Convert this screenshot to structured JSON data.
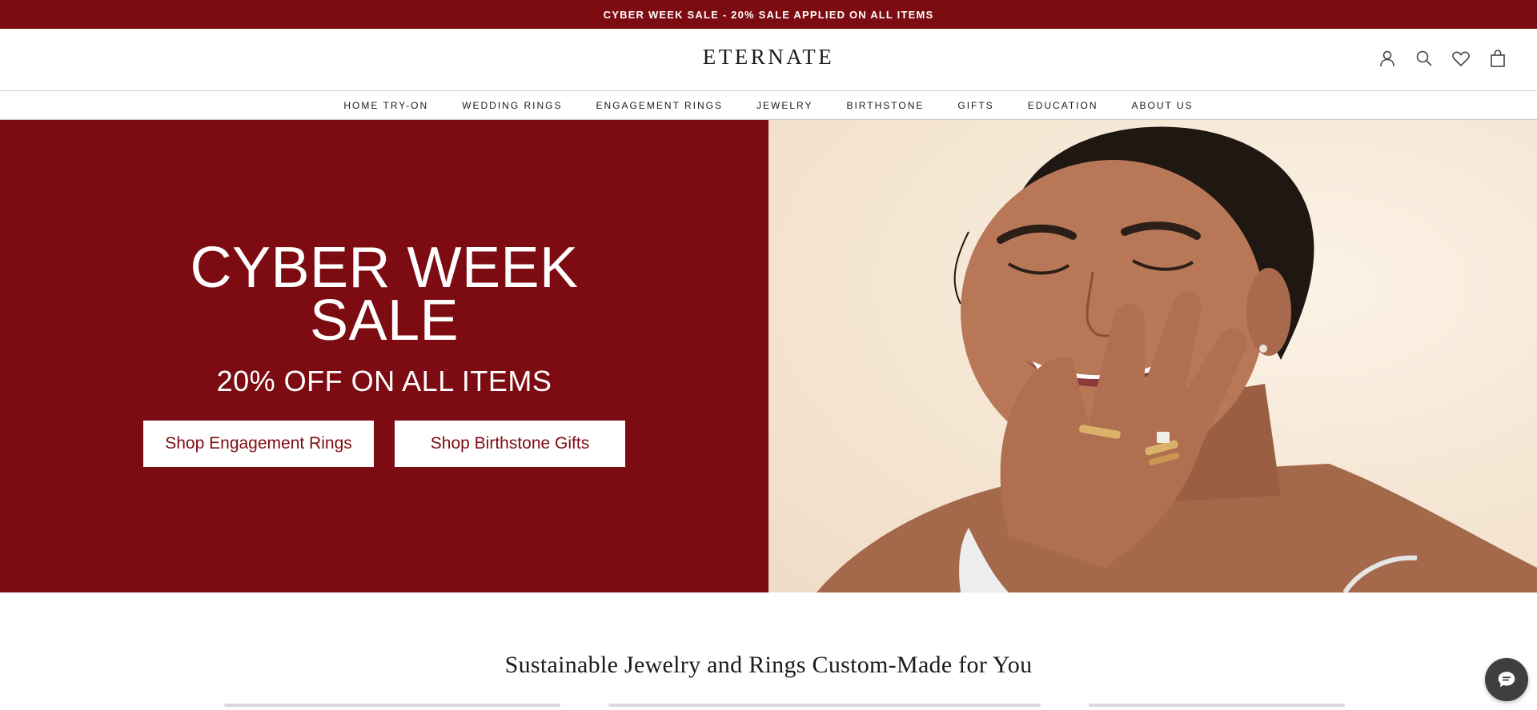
{
  "announcement": "CYBER WEEK SALE - 20% SALE APPLIED ON ALL ITEMS",
  "header": {
    "logo": "ETERNATE",
    "icons": [
      "account-icon",
      "search-icon",
      "wishlist-heart-icon",
      "shopping-bag-icon"
    ]
  },
  "nav": {
    "items": [
      {
        "label": "HOME TRY-ON"
      },
      {
        "label": "WEDDING RINGS"
      },
      {
        "label": "ENGAGEMENT RINGS"
      },
      {
        "label": "JEWELRY"
      },
      {
        "label": "BIRTHSTONE"
      },
      {
        "label": "GIFTS"
      },
      {
        "label": "EDUCATION"
      },
      {
        "label": "ABOUT US"
      }
    ]
  },
  "hero": {
    "title_line1": "CYBER WEEK",
    "title_line2": "SALE",
    "subtitle": "20% OFF ON ALL ITEMS",
    "button_engagement": "Shop Engagement Rings",
    "button_birthstone": "Shop Birthstone Gifts"
  },
  "section": {
    "title": "Sustainable Jewelry and Rings Custom-Made for You"
  },
  "colors": {
    "brand_red": "#7d0c12",
    "white": "#ffffff",
    "chat_button": "#3f3f3f"
  },
  "chat": {
    "icon": "chat-bubble-icon"
  }
}
